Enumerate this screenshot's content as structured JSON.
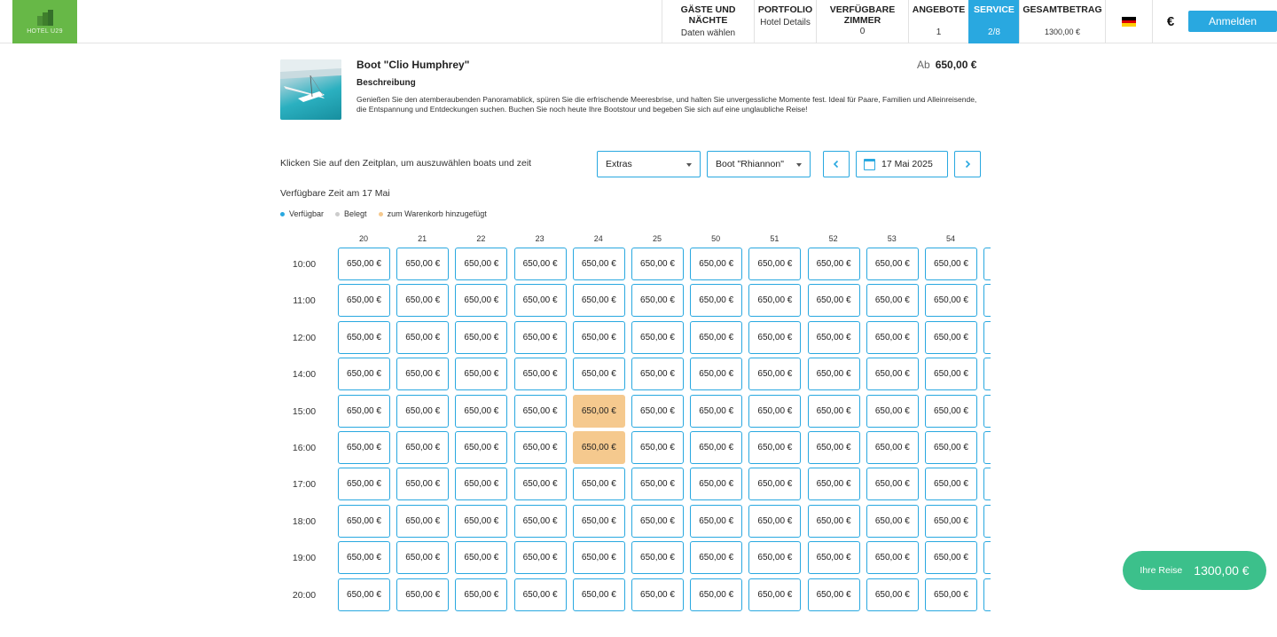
{
  "header": {
    "logo_text": "HOTEL U29",
    "nav": [
      {
        "title": "GÄSTE UND\nNÄCHTE",
        "sub": "Daten wählen",
        "active": false
      },
      {
        "title": "PORTFOLIO",
        "sub": "Hotel Details",
        "active": false
      },
      {
        "title": "VERFÜGBARE\nZIMMER",
        "sub": "0",
        "active": false
      },
      {
        "title": "ANGEBOTE",
        "sub": "1",
        "active": false
      },
      {
        "title": "SERVICE",
        "sub": "2/8",
        "active": true
      },
      {
        "title": "GESAMTBETRAG",
        "sub": "1300,00 €",
        "active": false
      }
    ],
    "language_icon": "german-flag-icon",
    "currency_symbol": "€",
    "login_label": "Anmelden"
  },
  "product": {
    "title": "Boot \"Clio Humphrey\"",
    "price_prefix": "Ab",
    "price": "650,00 €",
    "description_heading": "Beschreibung",
    "description": "Genießen Sie den atemberaubenden Panoramablick, spüren Sie die erfrischende Meeresbrise, und halten Sie unvergessliche Momente fest. Ideal für Paare, Familien und Alleinreisende, die Entspannung und Entdeckungen suchen. Buchen Sie noch heute Ihre Bootstour und begeben Sie sich auf eine unglaubliche Reise!"
  },
  "controls": {
    "hint": "Klicken Sie auf den Zeitplan, um auszuwählen boats und zeit",
    "extras_select": "Extras",
    "boat_select": "Boot \"Rhiannon\"",
    "date": "17 Mai 2025"
  },
  "schedule": {
    "title": "Verfügbare Zeit am 17 Mai",
    "legend": [
      {
        "label": "Verfügbar",
        "color": "#29a8e0"
      },
      {
        "label": "Belegt",
        "color": "#cccccc"
      },
      {
        "label": "zum Warenkorb hinzugefügt",
        "color": "#f5c98e"
      }
    ],
    "columns": [
      "20",
      "21",
      "22",
      "23",
      "24",
      "25",
      "50",
      "51",
      "52",
      "53",
      "54",
      ""
    ],
    "times": [
      "10:00",
      "11:00",
      "12:00",
      "14:00",
      "15:00",
      "16:00",
      "17:00",
      "18:00",
      "19:00",
      "20:00"
    ],
    "slot_price": "650,00 €",
    "in_cart": [
      {
        "time": "15:00",
        "column": "24"
      },
      {
        "time": "16:00",
        "column": "24"
      }
    ]
  },
  "trip": {
    "label": "Ihre Reise",
    "total": "1300,00 €"
  },
  "colors": {
    "accent": "#29a8e0",
    "brand_green": "#67b847",
    "cart": "#f5c98e",
    "trip_button": "#3cc08b"
  }
}
